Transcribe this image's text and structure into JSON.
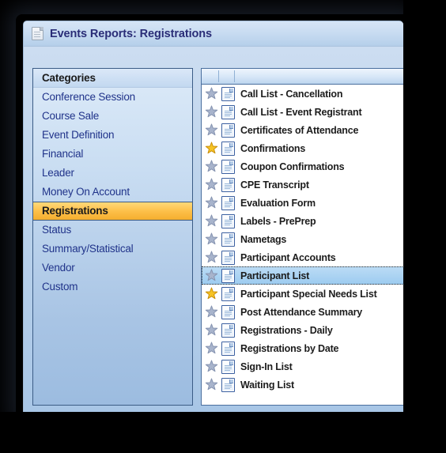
{
  "window": {
    "title": "Events Reports: Registrations",
    "title_icon": "document-icon",
    "accent_selected_category": "#f5ae2e",
    "accent_selected_row": "#9ccbf0",
    "title_color": "#2a2d77"
  },
  "sidebar": {
    "header": "Categories",
    "items": [
      {
        "label": "Conference Session",
        "selected": false
      },
      {
        "label": "Course Sale",
        "selected": false
      },
      {
        "label": "Event Definition",
        "selected": false
      },
      {
        "label": "Financial",
        "selected": false
      },
      {
        "label": "Leader",
        "selected": false
      },
      {
        "label": "Money On Account",
        "selected": false
      },
      {
        "label": "Registrations",
        "selected": true
      },
      {
        "label": "Status",
        "selected": false
      },
      {
        "label": "Summary/Statistical",
        "selected": false
      },
      {
        "label": "Vendor",
        "selected": false
      },
      {
        "label": "Custom",
        "selected": false
      }
    ]
  },
  "report_list": {
    "columns": [
      "",
      "",
      ""
    ],
    "rows": [
      {
        "label": "Call List - Cancellation",
        "favorite": false,
        "selected": false,
        "icon": "report-document-icon",
        "star": "star-icon"
      },
      {
        "label": "Call List - Event Registrant",
        "favorite": false,
        "selected": false,
        "icon": "report-document-icon",
        "star": "star-icon"
      },
      {
        "label": "Certificates of Attendance",
        "favorite": false,
        "selected": false,
        "icon": "report-document-icon",
        "star": "star-icon"
      },
      {
        "label": "Confirmations",
        "favorite": true,
        "selected": false,
        "icon": "report-document-icon",
        "star": "star-icon"
      },
      {
        "label": "Coupon Confirmations",
        "favorite": false,
        "selected": false,
        "icon": "report-document-icon",
        "star": "star-icon"
      },
      {
        "label": "CPE Transcript",
        "favorite": false,
        "selected": false,
        "icon": "report-document-icon",
        "star": "star-icon"
      },
      {
        "label": "Evaluation Form",
        "favorite": false,
        "selected": false,
        "icon": "report-document-icon",
        "star": "star-icon"
      },
      {
        "label": "Labels - PrePrep",
        "favorite": false,
        "selected": false,
        "icon": "report-document-icon",
        "star": "star-icon"
      },
      {
        "label": "Nametags",
        "favorite": false,
        "selected": false,
        "icon": "report-document-icon",
        "star": "star-icon"
      },
      {
        "label": "Participant Accounts",
        "favorite": false,
        "selected": false,
        "icon": "report-document-icon",
        "star": "star-icon"
      },
      {
        "label": "Participant List",
        "favorite": false,
        "selected": true,
        "icon": "report-document-icon",
        "star": "star-icon"
      },
      {
        "label": "Participant Special Needs List",
        "favorite": true,
        "selected": false,
        "icon": "report-document-icon",
        "star": "star-icon"
      },
      {
        "label": "Post Attendance Summary",
        "favorite": false,
        "selected": false,
        "icon": "report-document-icon",
        "star": "star-icon"
      },
      {
        "label": "Registrations - Daily",
        "favorite": false,
        "selected": false,
        "icon": "report-document-icon",
        "star": "star-icon"
      },
      {
        "label": "Registrations by Date",
        "favorite": false,
        "selected": false,
        "icon": "report-document-icon",
        "star": "star-icon"
      },
      {
        "label": "Sign-In List",
        "favorite": false,
        "selected": false,
        "icon": "report-document-icon",
        "star": "star-icon"
      },
      {
        "label": "Waiting List",
        "favorite": false,
        "selected": false,
        "icon": "report-document-icon",
        "star": "star-icon"
      }
    ]
  },
  "colors": {
    "favorite_star": "#f6c324",
    "plain_star": "#a8b4cc",
    "category_text": "#20338a",
    "row_text": "#1c1c1c"
  }
}
